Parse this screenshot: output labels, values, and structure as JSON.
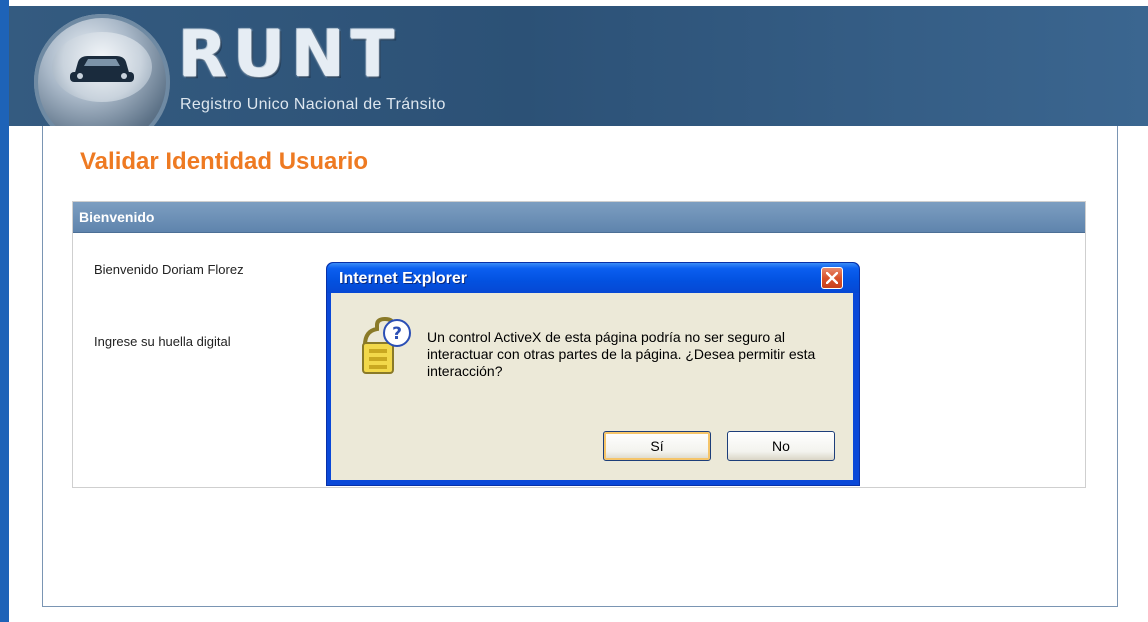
{
  "header": {
    "brand": "RUNT",
    "subtitle": "Registro Unico Nacional de Tránsito"
  },
  "page": {
    "title": "Validar Identidad Usuario"
  },
  "panel": {
    "header": "Bienvenido",
    "welcome_text": "Bienvenido Doriam Florez",
    "fingerprint_prompt": "Ingrese su huella digital"
  },
  "dialog": {
    "title": "Internet Explorer",
    "message": "Un control ActiveX de esta página podría no ser seguro al interactuar con otras partes de la página. ¿Desea permitir esta interacción?",
    "yes_label": "Sí",
    "no_label": "No",
    "icon": "security-warning-icon"
  },
  "colors": {
    "title_orange": "#ee7a22",
    "header_blue": "#5f84ad",
    "xp_title_blue": "#0351e0"
  }
}
